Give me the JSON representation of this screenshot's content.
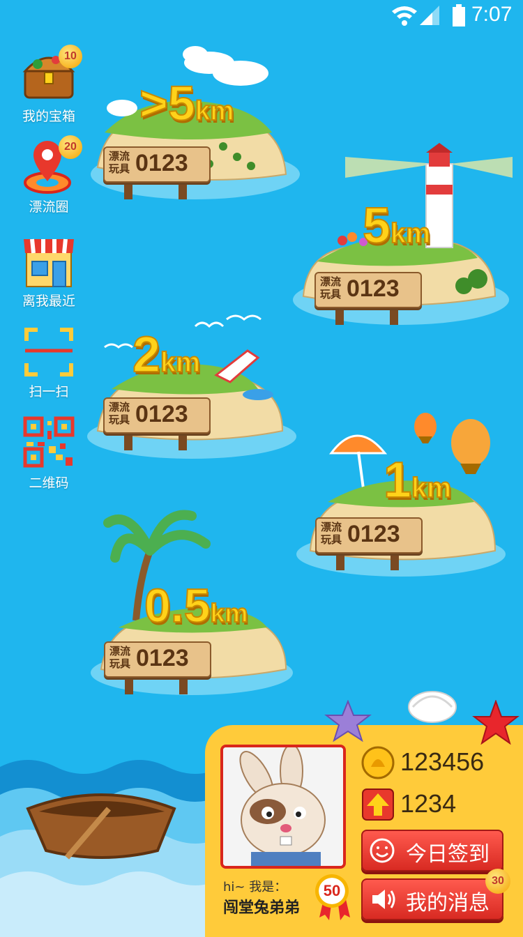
{
  "status_bar": {
    "time": "7:07"
  },
  "menu": [
    {
      "label": "我的宝箱",
      "badge": "10",
      "icon": "treasure-chest-icon"
    },
    {
      "label": "漂流圈",
      "badge": "20",
      "icon": "location-pin-icon"
    },
    {
      "label": "离我最近",
      "icon": "shop-icon"
    },
    {
      "label": "扫一扫",
      "icon": "scan-icon"
    },
    {
      "label": "二维码",
      "icon": "qr-code-icon"
    }
  ],
  "islands": [
    {
      "distance": ">5",
      "unit": "km",
      "sign_label": "漂流玩具",
      "count": "0123"
    },
    {
      "distance": "5",
      "unit": "km",
      "sign_label": "漂流玩具",
      "count": "0123"
    },
    {
      "distance": "2",
      "unit": "km",
      "sign_label": "漂流玩具",
      "count": "0123"
    },
    {
      "distance": "1",
      "unit": "km",
      "sign_label": "漂流玩具",
      "count": "0123"
    },
    {
      "distance": "0.5",
      "unit": "km",
      "sign_label": "漂流玩具",
      "count": "0123"
    }
  ],
  "profile": {
    "greeting": "hi~ 我是：",
    "name": "闯堂兔弟弟",
    "level": "50",
    "coins": "123456",
    "points": "1234"
  },
  "buttons": {
    "checkin": "今日签到",
    "messages": "我的消息",
    "messages_badge": "30"
  },
  "colors": {
    "sea": "#1fb6ee",
    "sand": "#ffcb3a",
    "button": "#e0342a",
    "accent_gold": "#ffd21a"
  }
}
